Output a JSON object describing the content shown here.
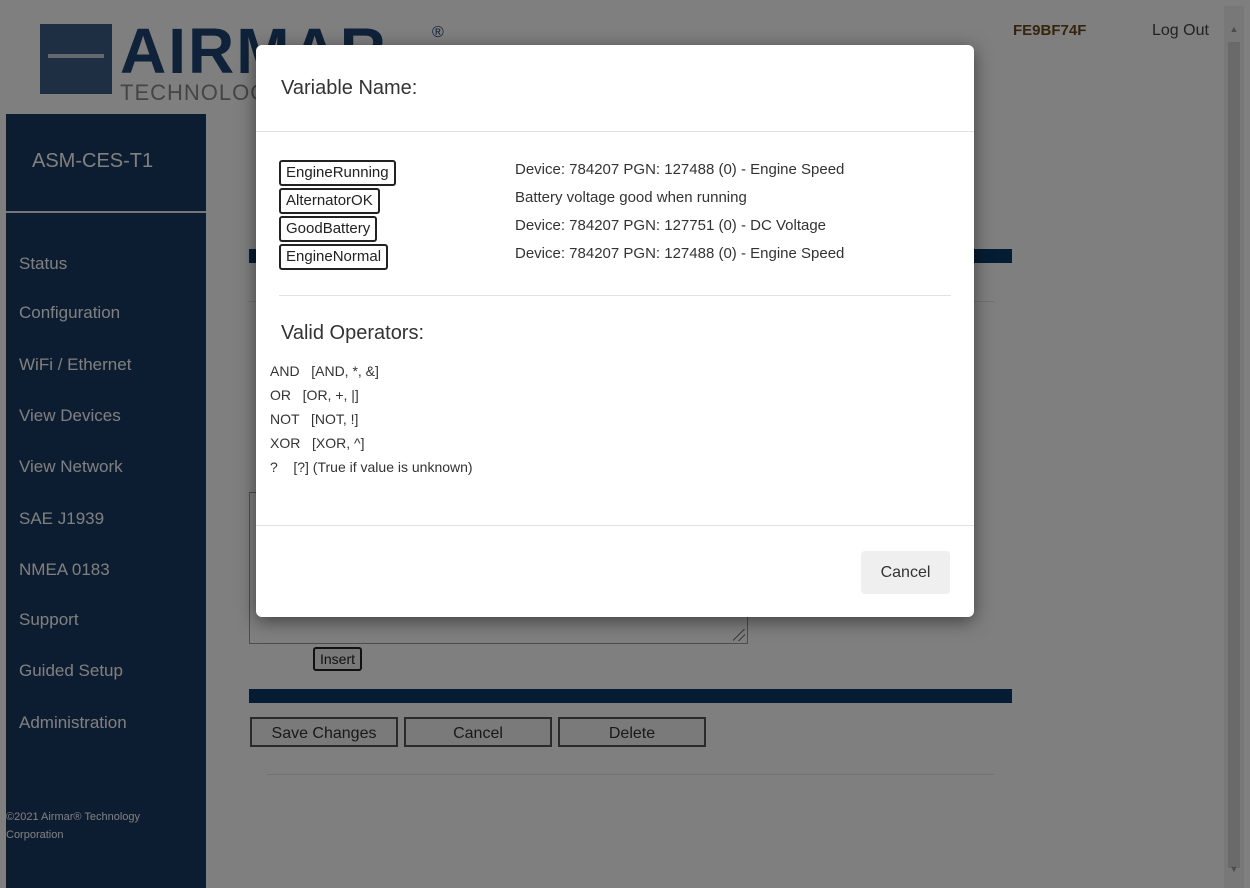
{
  "header": {
    "logo_word": "AIRMAR",
    "logo_reg": "®",
    "logo_sub": "TECHNOLOGY",
    "device_id": "FE9BF74F",
    "logout_label": "Log Out"
  },
  "sidebar": {
    "device_name": "ASM-CES-T1",
    "items": [
      {
        "label": "Status"
      },
      {
        "label": "Configuration"
      },
      {
        "label": "WiFi / Ethernet"
      },
      {
        "label": "View Devices"
      },
      {
        "label": "View Network"
      },
      {
        "label": "SAE J1939"
      },
      {
        "label": "NMEA 0183"
      },
      {
        "label": "Support"
      },
      {
        "label": "Guided Setup"
      },
      {
        "label": "Administration"
      }
    ],
    "copyright_line1": "©2021 Airmar® Technology",
    "copyright_line2": "Corporation"
  },
  "form": {
    "insert_label": "Insert",
    "save_label": "Save Changes",
    "cancel_label": "Cancel",
    "delete_label": "Delete"
  },
  "modal": {
    "title": "Variable Name:",
    "variables": [
      {
        "name": "EngineRunning",
        "description": "Device: 784207 PGN: 127488 (0) - Engine Speed"
      },
      {
        "name": "AlternatorOK",
        "description": "Battery voltage good when running"
      },
      {
        "name": "GoodBattery",
        "description": "Device: 784207 PGN: 127751 (0) - DC Voltage"
      },
      {
        "name": "EngineNormal",
        "description": "Device: 784207 PGN: 127488 (0) - Engine Speed"
      }
    ],
    "operators_title": "Valid Operators:",
    "operators": [
      "AND   [AND, *, &]",
      "OR   [OR, +, |]",
      "NOT   [NOT, !]",
      "XOR   [XOR, ^]",
      "?    [?] (True if value is unknown)"
    ],
    "cancel_label": "Cancel"
  }
}
